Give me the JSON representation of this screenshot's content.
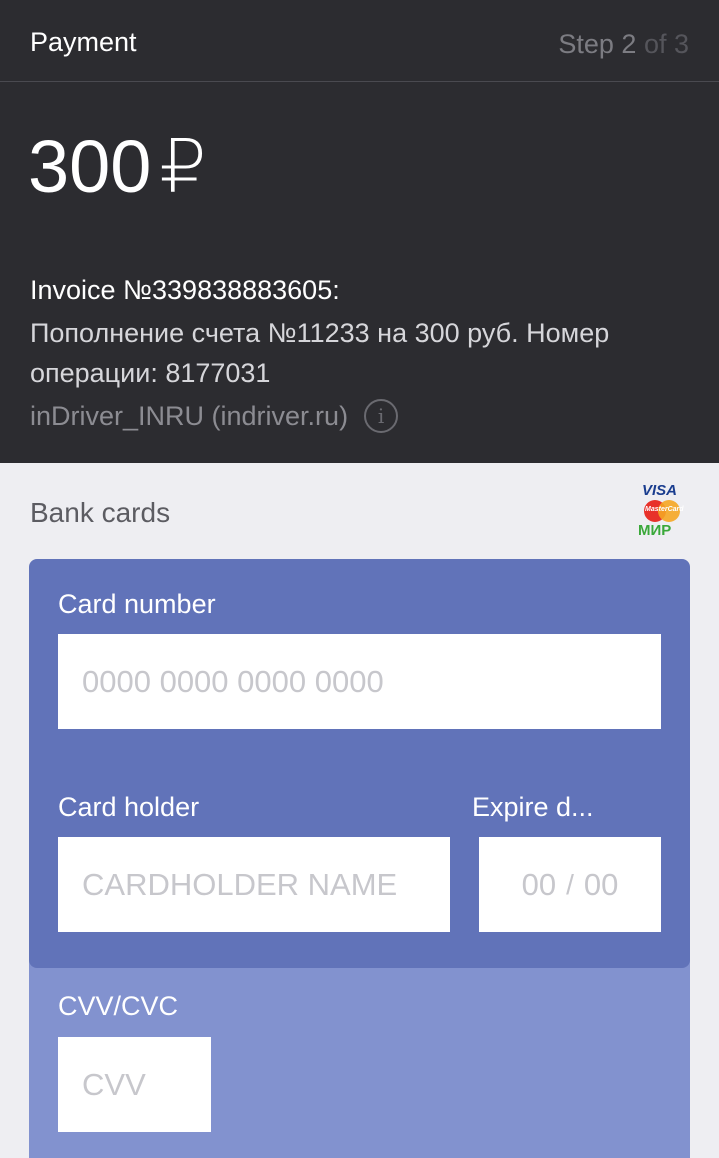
{
  "header": {
    "title": "Payment",
    "step_label": "Step 2",
    "step_of": "of 3"
  },
  "summary": {
    "amount": "300",
    "currency_symbol": "₽",
    "invoice_title": "Invoice №339838883605:",
    "invoice_description": "Пополнение счета №11233 на 300 руб. Номер операции: 8177031",
    "merchant": "inDriver_INRU (indriver.ru)",
    "info_icon": "info-icon"
  },
  "bank_cards": {
    "label": "Bank cards",
    "brands": {
      "visa": "VISA",
      "mastercard": "MasterCard",
      "mir": "МИР"
    }
  },
  "form": {
    "card_number": {
      "label": "Card number",
      "placeholder": "0000 0000 0000 0000"
    },
    "card_holder": {
      "label": "Card holder",
      "placeholder": "CARDHOLDER NAME"
    },
    "expire": {
      "label": "Expire d...",
      "month_placeholder": "00",
      "separator": "/",
      "year_placeholder": "00"
    },
    "cvv": {
      "label": "CVV/CVC",
      "placeholder": "CVV"
    }
  },
  "colors": {
    "header_bg": "#2c2c30",
    "card_front": "#6173b9",
    "card_back": "#8292cf",
    "page_bg": "#eeeef2"
  }
}
